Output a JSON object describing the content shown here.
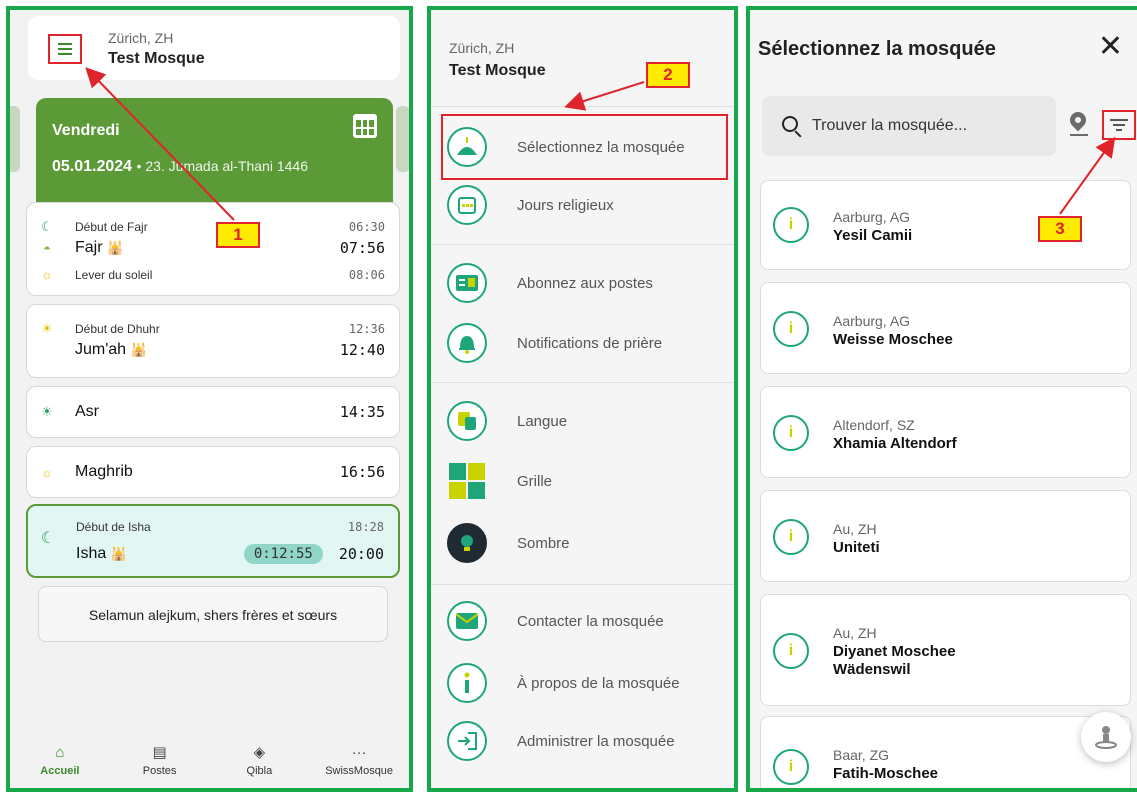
{
  "annotations": [
    "1",
    "2",
    "3"
  ],
  "home": {
    "city": "Zürich, ZH",
    "mosque": "Test Mosque",
    "day": "Vendredi",
    "date": "05.01.2024",
    "hijri": "• 23. Jumada al-Thani 1446",
    "fajr_start_label": "Début de Fajr",
    "fajr_start_time": "06:30",
    "fajr_label": "Fajr",
    "fajr_time": "07:56",
    "sunrise_label": "Lever du soleil",
    "sunrise_time": "08:06",
    "dhuhr_start_label": "Début de Dhuhr",
    "dhuhr_start_time": "12:36",
    "jumah_label": "Jum'ah",
    "jumah_time": "12:40",
    "asr_label": "Asr",
    "asr_time": "14:35",
    "maghrib_label": "Maghrib",
    "maghrib_time": "16:56",
    "isha_start_label": "Début de Isha",
    "isha_start_time": "18:28",
    "isha_label": "Isha",
    "isha_countdown": "0:12:55",
    "isha_time": "20:00",
    "greeting": "Selamun alejkum, shers frères et sœurs",
    "nav": [
      {
        "label": "Accueil"
      },
      {
        "label": "Postes"
      },
      {
        "label": "Qibla"
      },
      {
        "label": "SwissMosque"
      }
    ]
  },
  "menu": {
    "city": "Zürich, ZH",
    "mosque": "Test Mosque",
    "items": [
      {
        "label": "Sélectionnez la mosquée"
      },
      {
        "label": "Jours religieux"
      },
      {
        "label": "Abonnez aux postes"
      },
      {
        "label": "Notifications de prière"
      },
      {
        "label": "Langue"
      },
      {
        "label": "Grille"
      },
      {
        "label": "Sombre"
      },
      {
        "label": "Contacter la mosquée"
      },
      {
        "label": "À propos de la mosquée"
      },
      {
        "label": "Administrer la mosquée"
      }
    ]
  },
  "select": {
    "title": "Sélectionnez la mosquée",
    "close": "✕",
    "search_placeholder": "Trouver la mosquée...",
    "mosques": [
      {
        "location": "Aarburg, AG",
        "name": "Yesil Camii"
      },
      {
        "location": "Aarburg, AG",
        "name": "Weisse Moschee"
      },
      {
        "location": "Altendorf, SZ",
        "name": "Xhamia Altendorf"
      },
      {
        "location": "Au, ZH",
        "name": "Uniteti"
      },
      {
        "location": "Au, ZH",
        "name": "Diyanet Moschee",
        "name2": "Wädenswil"
      },
      {
        "location": "Baar, ZG",
        "name": "Fatih-Moschee"
      }
    ]
  }
}
